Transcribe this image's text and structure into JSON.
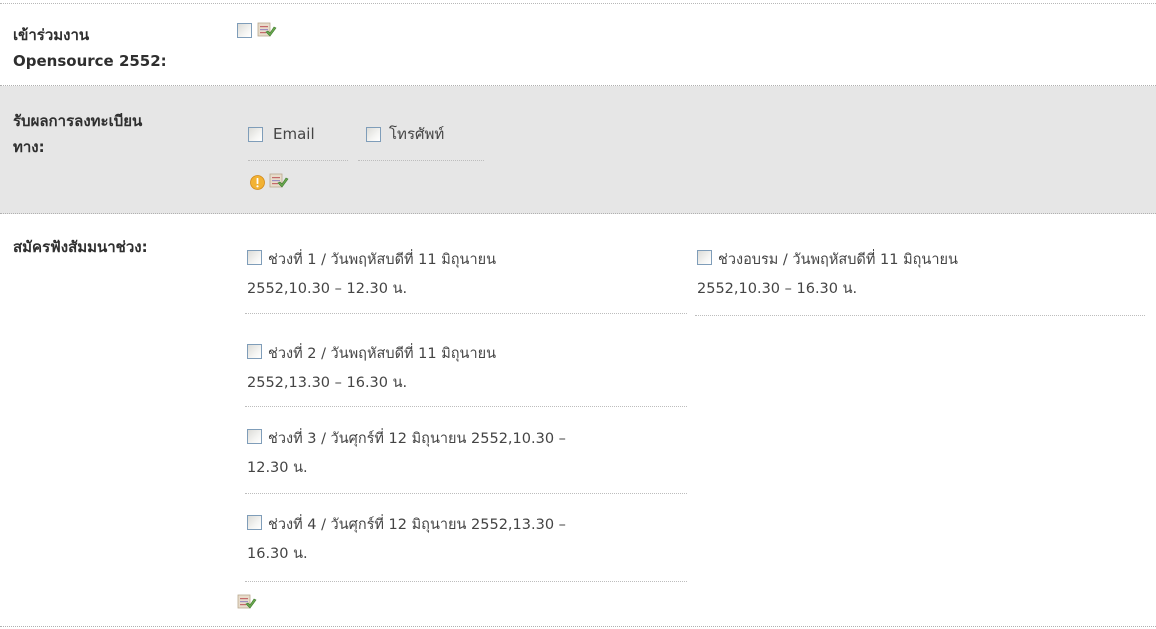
{
  "form": {
    "attend": {
      "label": "เข้าร่วมงาน\nOpensource 2552:"
    },
    "receive": {
      "label": "รับผลการลงทะเบียน\nทาง:",
      "options": [
        {
          "label": "Email"
        },
        {
          "label": "โทรศัพท์"
        }
      ]
    },
    "sessions": {
      "label": "สมัครฟังสัมมนาช่วง:",
      "items": [
        {
          "line1": "ช่วงที่ 1 / วันพฤหัสบดีที่ 11 มิถุนายน",
          "line2": "2552,10.30 – 12.30 น."
        },
        {
          "line1": "ช่วงที่ 2 / วันพฤหัสบดีที่ 11 มิถุนายน",
          "line2": "2552,13.30 – 16.30 น."
        },
        {
          "line1": "ช่วงที่ 3 / วันศุกร์ที่ 12 มิถุนายน 2552,10.30 –",
          "line2": "12.30 น."
        },
        {
          "line1": "ช่วงที่ 4 / วันศุกร์ที่ 12 มิถุนายน 2552,13.30 –",
          "line2": "16.30 น."
        },
        {
          "line1": "ช่วงอบรม / วันพฤหัสบดีที่ 11 มิถุนายน",
          "line2": "2552,10.30 – 16.30 น."
        }
      ]
    }
  },
  "icons": {
    "edit": "edit-icon",
    "warning": "warning-icon"
  },
  "colors": {
    "alt_row": "#e6e6e6",
    "warning": "#f0a830",
    "edit_green": "#6aa84f"
  }
}
